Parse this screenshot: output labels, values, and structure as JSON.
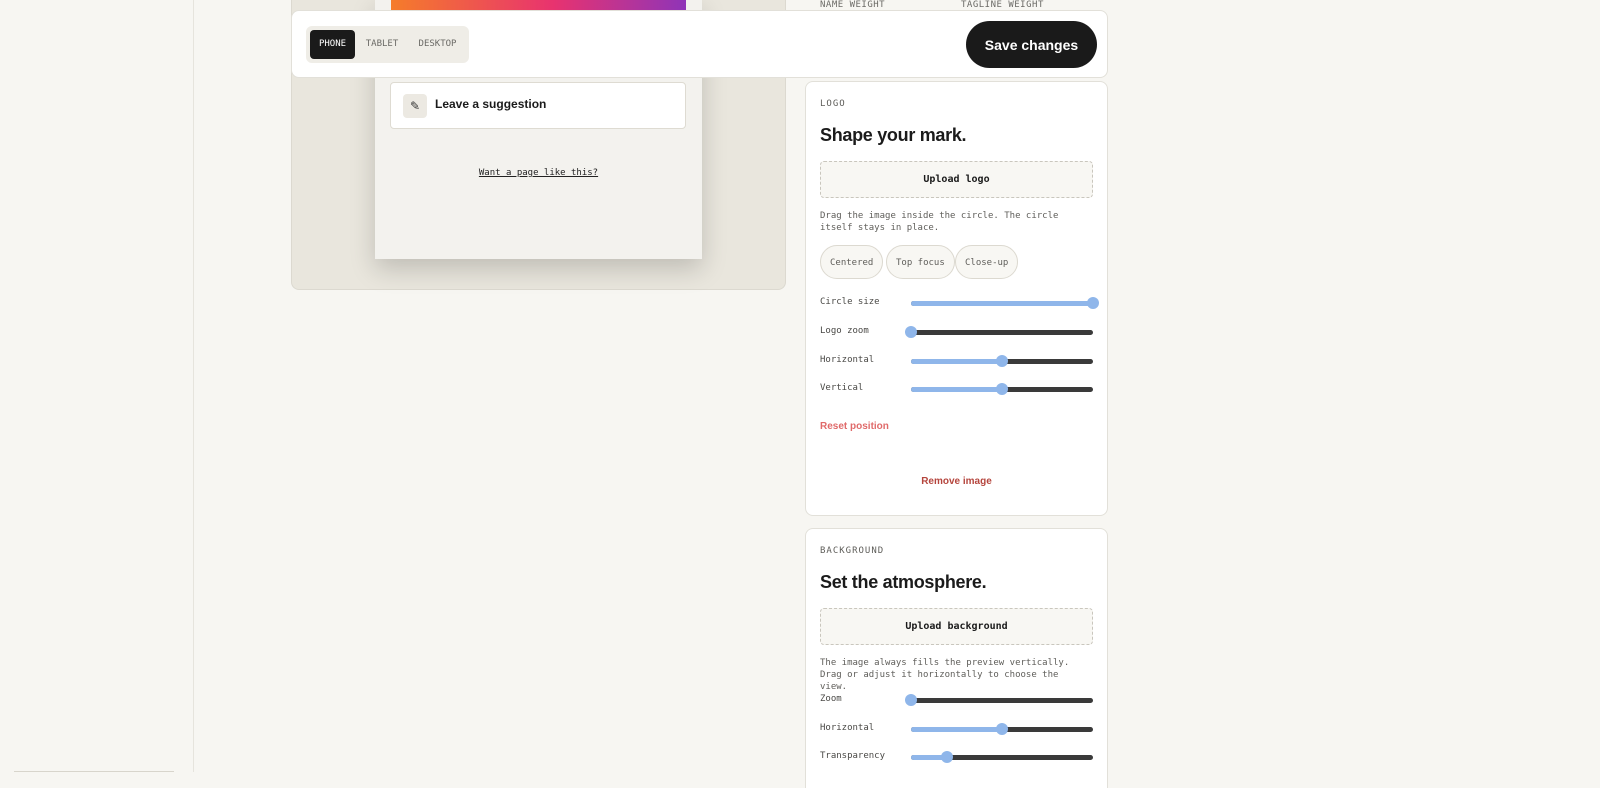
{
  "top_labels": {
    "name_weight": "NAME WEIGHT",
    "tagline_weight": "TAGLINE WEIGHT"
  },
  "toolbar": {
    "tabs": [
      {
        "label": "PHONE",
        "active": true
      },
      {
        "label": "TABLET",
        "active": false
      },
      {
        "label": "DESKTOP",
        "active": false
      }
    ],
    "save_label": "Save changes"
  },
  "preview": {
    "suggestion_label": "Leave a suggestion",
    "suggestion_icon": "pencil-icon",
    "want_page_link": "Want a page like this?",
    "banner_colors": [
      "#f57c2a",
      "#e8336f",
      "#8f34b8"
    ]
  },
  "logo_panel": {
    "eyebrow": "LOGO",
    "title": "Shape your mark.",
    "upload_label": "Upload logo",
    "help": "Drag the image inside the circle. The circle itself stays in place.",
    "presets": [
      "Centered",
      "Top focus",
      "Close-up"
    ],
    "sliders": [
      {
        "label": "Circle size",
        "value": 1.0
      },
      {
        "label": "Logo zoom",
        "value": 0.0
      },
      {
        "label": "Horizontal",
        "value": 0.5
      },
      {
        "label": "Vertical",
        "value": 0.5
      }
    ],
    "reset_label": "Reset position",
    "remove_label": "Remove image"
  },
  "background_panel": {
    "eyebrow": "BACKGROUND",
    "title": "Set the atmosphere.",
    "upload_label": "Upload background",
    "help": "The image always fills the preview vertically. Drag or adjust it horizontally to choose the view.",
    "sliders": [
      {
        "label": "Zoom",
        "value": 0.0
      },
      {
        "label": "Horizontal",
        "value": 0.5
      },
      {
        "label": "Transparency",
        "value": 0.2
      }
    ]
  },
  "colors": {
    "accent": "#8fb6ea",
    "dark": "#1a1a1a",
    "danger": "#b5453d",
    "reset": "#e06a6a"
  }
}
